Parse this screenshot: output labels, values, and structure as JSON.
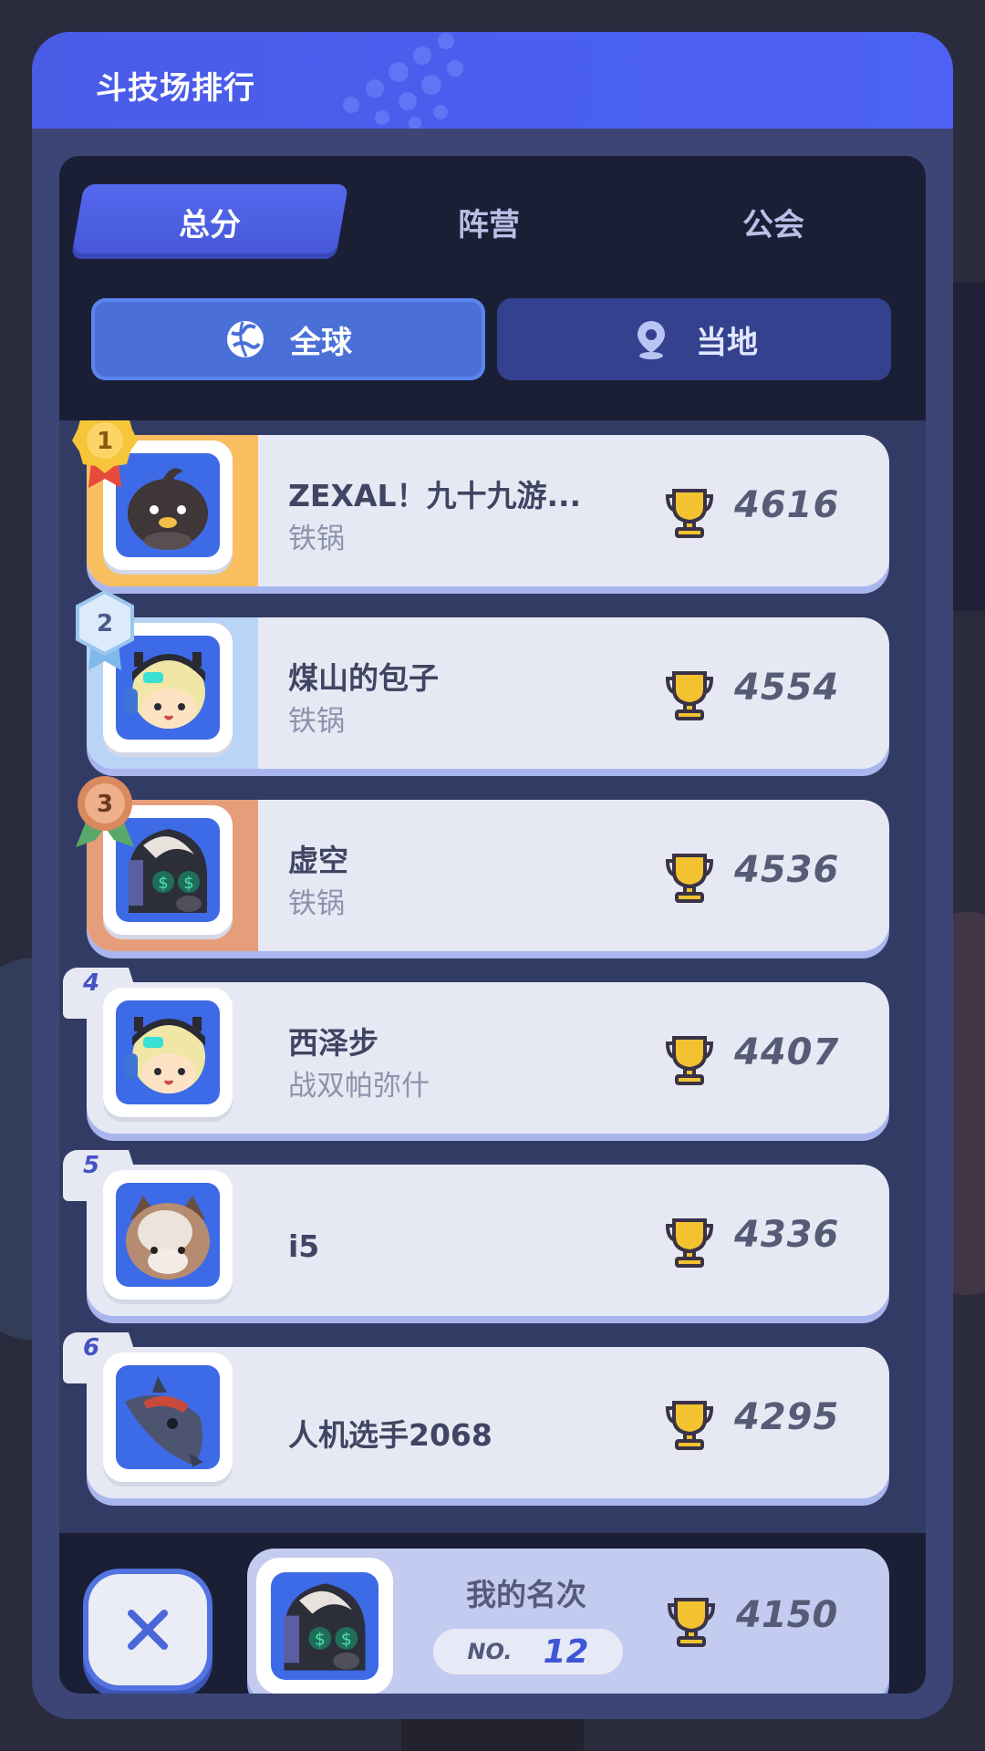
{
  "header": {
    "title": "斗技场排行"
  },
  "tabs": [
    {
      "label": "总分",
      "active": true
    },
    {
      "label": "阵营",
      "active": false
    },
    {
      "label": "公会",
      "active": false
    }
  ],
  "scope": [
    {
      "label": "全球",
      "icon": "globe-icon",
      "active": true
    },
    {
      "label": "当地",
      "icon": "location-pin-icon",
      "active": false
    }
  ],
  "leaderboard": [
    {
      "rank": "1",
      "name": "ZEXAL！九十九游...",
      "guild": "铁锅",
      "score": "4616",
      "avatar": "penguin-avatar",
      "medal": "gold"
    },
    {
      "rank": "2",
      "name": "煤山的包子",
      "guild": "铁锅",
      "score": "4554",
      "avatar": "headset-kid-avatar",
      "medal": "silver"
    },
    {
      "rank": "3",
      "name": "虚空",
      "guild": "铁锅",
      "score": "4536",
      "avatar": "masked-hood-avatar",
      "medal": "bronze"
    },
    {
      "rank": "4",
      "name": "西泽步",
      "guild": "战双帕弥什",
      "score": "4407",
      "avatar": "headset-kid-avatar"
    },
    {
      "rank": "5",
      "name": "i5",
      "guild": "",
      "score": "4336",
      "avatar": "hamster-avatar"
    },
    {
      "rank": "6",
      "name": "人机选手2068",
      "guild": "",
      "score": "4295",
      "avatar": "fish-avatar"
    }
  ],
  "my_rank": {
    "label": "我的名次",
    "no_label": "NO.",
    "rank": "12",
    "score": "4150",
    "avatar": "masked-hood-avatar"
  },
  "colors": {
    "header_blue": "#4a5be6",
    "panel": "#3c4576",
    "card": "#e6e9f3",
    "accent": "#3f55d8",
    "gold": "#f8be5f",
    "silver": "#b9d4f6",
    "bronze": "#e69e7a",
    "trophy": "#f2c230"
  }
}
